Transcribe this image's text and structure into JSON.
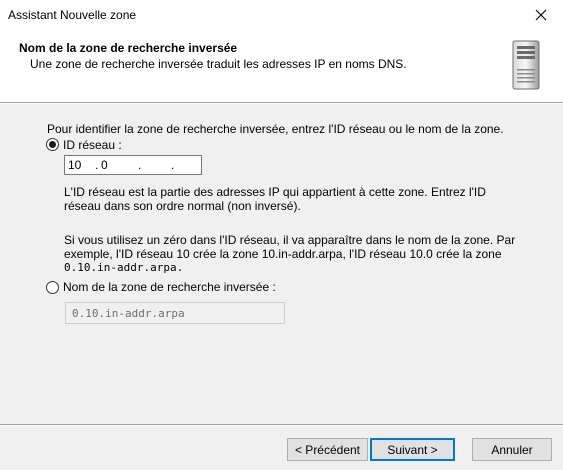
{
  "window": {
    "title": "Assistant Nouvelle zone"
  },
  "header": {
    "title": "Nom de la zone de recherche inversée",
    "subtitle": "Une zone de recherche inversée traduit les adresses IP en noms DNS."
  },
  "content": {
    "instruction": "Pour identifier la zone de recherche inversée, entrez l'ID réseau ou le nom de la zone.",
    "option_network_id": {
      "label": "ID réseau :",
      "selected": true,
      "octets": [
        "10",
        "0",
        "",
        ""
      ]
    },
    "help_1_line1": "L'ID réseau est la partie des adresses IP qui appartient à cette zone. Entrez l'ID",
    "help_1_line2": "réseau dans son ordre normal (non inversé).",
    "help_2_line1": "Si vous utilisez un zéro dans l'ID réseau, il va apparaître dans le nom de la zone. Par",
    "help_2_line2": "exemple, l'ID réseau 10 crée la zone 10.in-addr.arpa, l'ID réseau 10.0 crée la zone",
    "help_2_line3": "0.10.in-addr.arpa.",
    "option_zone_name": {
      "label": "Nom de la zone de recherche inversée :",
      "selected": false,
      "value": "0.10.in-addr.arpa"
    }
  },
  "footer": {
    "back_label": "< Précédent",
    "next_label": "Suivant >",
    "cancel_label": "Annuler"
  },
  "colors": {
    "accent": "#0078d7",
    "panel": "#f0f0f0",
    "disabled_text": "#6d6d6d"
  },
  "icons": {
    "close": "close-icon",
    "header_graphic": "server-icon"
  }
}
